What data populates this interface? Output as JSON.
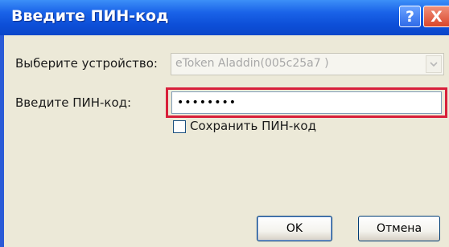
{
  "window": {
    "title": "Введите ПИН-код"
  },
  "titlebar": {
    "help_glyph": "?",
    "close_glyph": "X"
  },
  "form": {
    "device_label": "Выберите устройство:",
    "device_value": "eToken Aladdin(005c25a7        )",
    "pin_label": "Введите ПИН-код:",
    "pin_value": "********",
    "save_pin_label": "Сохранить ПИН-код",
    "save_pin_checked": false
  },
  "buttons": {
    "ok": "OK",
    "cancel": "Отмена"
  },
  "colors": {
    "titlebar": "#0a46c9",
    "highlight": "#d8203a",
    "client": "#ece9d8"
  }
}
